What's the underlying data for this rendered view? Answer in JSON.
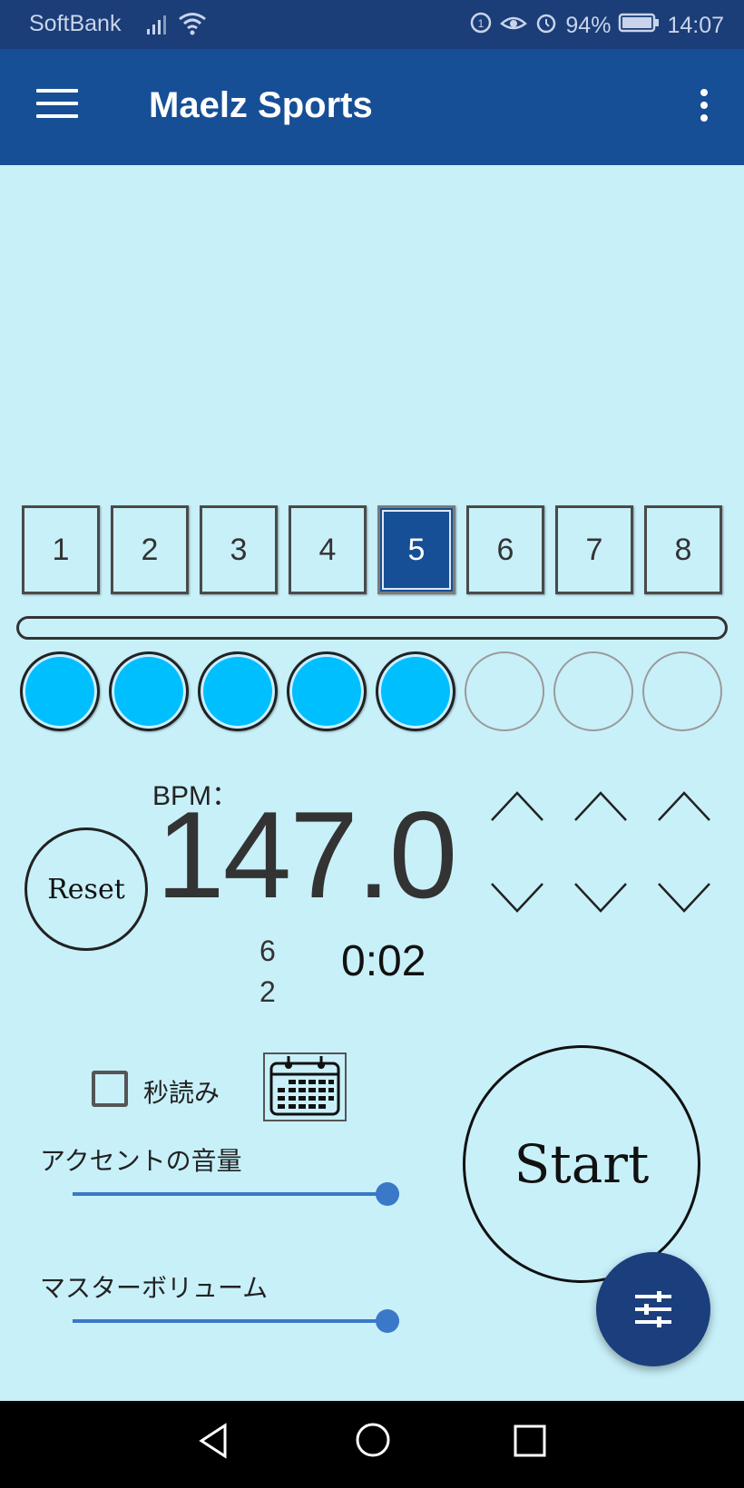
{
  "status_bar": {
    "carrier": "SoftBank",
    "battery_percent": "94%",
    "time": "14:07",
    "icons": [
      "signal-icon",
      "wifi-icon",
      "data-saver-icon",
      "eye-comfort-icon",
      "alarm-icon",
      "battery-icon"
    ]
  },
  "app_bar": {
    "title": "Maelz Sports",
    "menu_icon": "hamburger-menu-icon",
    "overflow_icon": "more-vert-icon"
  },
  "beats": {
    "items": [
      "1",
      "2",
      "3",
      "4",
      "5",
      "6",
      "7",
      "8"
    ],
    "active_index": 4,
    "active_color": "#174f96"
  },
  "progress": {
    "value": 0
  },
  "beat_dots": {
    "filled_count": 5,
    "total": 8,
    "on_color": "#00bfff"
  },
  "tempo": {
    "label": "BPM：",
    "value": "147.0",
    "reset_label": "Reset"
  },
  "counters": {
    "top": "6",
    "bottom": "2",
    "elapsed": "0:02"
  },
  "countdown": {
    "label": "秒読み",
    "checked": false,
    "calendar_icon": "calendar-icon"
  },
  "accent_volume": {
    "label": "アクセントの音量",
    "value": 1.0
  },
  "master_volume": {
    "label": "マスターボリューム",
    "value": 1.0
  },
  "start_label": "Start",
  "fab_icon": "tune-icon",
  "nav_bar": {
    "icons": [
      "back-icon",
      "home-icon",
      "recents-icon"
    ]
  }
}
